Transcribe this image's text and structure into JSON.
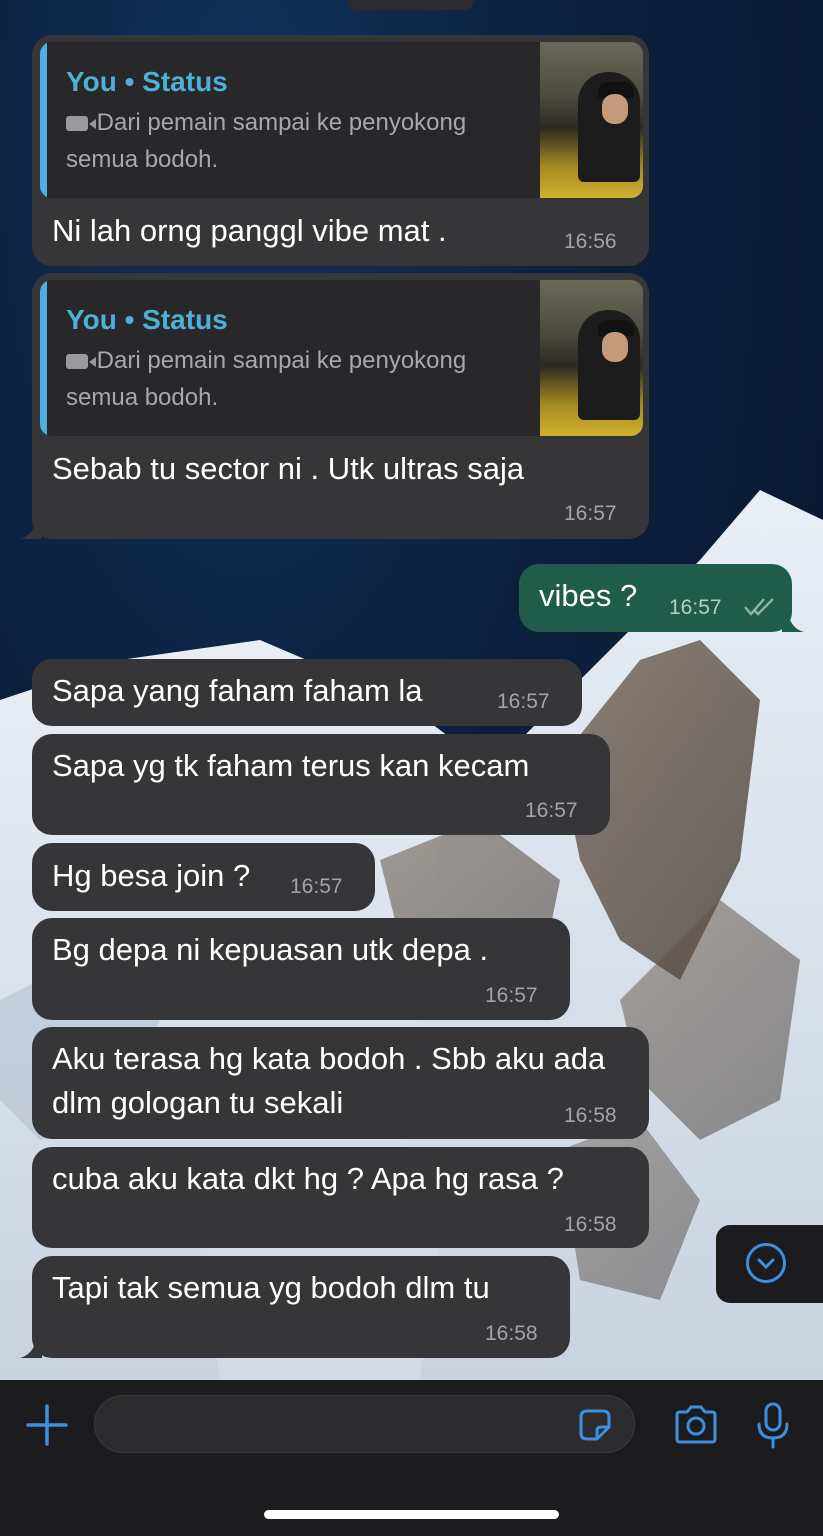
{
  "wallpaper": {
    "description_icon": "mountain-wallpaper"
  },
  "messages": [
    {
      "direction": "in",
      "quote": {
        "author": "You • Status",
        "icon": "video-camera-icon",
        "text": "Dari pemain sampai ke penyokong semua bodoh."
      },
      "text": "Ni lah orng panggl vibe mat .",
      "time": "16:56"
    },
    {
      "direction": "in",
      "quote": {
        "author": "You • Status",
        "icon": "video-camera-icon",
        "text": "Dari pemain sampai ke penyokong semua bodoh."
      },
      "text": "Sebab tu sector ni . Utk ultras saja",
      "time": "16:57"
    },
    {
      "direction": "out",
      "text": "vibes ?",
      "time": "16:57",
      "status": "read"
    },
    {
      "direction": "in",
      "text": "Sapa yang faham faham la",
      "time": "16:57"
    },
    {
      "direction": "in",
      "text": "Sapa yg tk faham terus kan kecam",
      "time": "16:57"
    },
    {
      "direction": "in",
      "text": "Hg besa join ?",
      "time": "16:57"
    },
    {
      "direction": "in",
      "text": "Bg depa ni kepuasan utk depa .",
      "time": "16:57"
    },
    {
      "direction": "in",
      "text": "Aku terasa hg kata bodoh . Sbb aku ada dlm gologan tu sekali",
      "time": "16:58"
    },
    {
      "direction": "in",
      "text": "cuba aku kata dkt hg ? Apa hg rasa ?",
      "time": "16:58"
    },
    {
      "direction": "in",
      "text": "Tapi tak semua yg bodoh dlm tu",
      "time": "16:58"
    }
  ],
  "composer": {
    "add_icon": "plus-icon",
    "input_value": "",
    "sticker_icon": "sticker-icon",
    "camera_icon": "camera-icon",
    "mic_icon": "microphone-icon"
  },
  "scroll_button_icon": "chevron-down-icon",
  "colors": {
    "incoming_bubble": "#363638",
    "outgoing_bubble": "#1f5c4a",
    "accent": "#3d8fe0",
    "quote_bar": "#4fb0e0"
  }
}
